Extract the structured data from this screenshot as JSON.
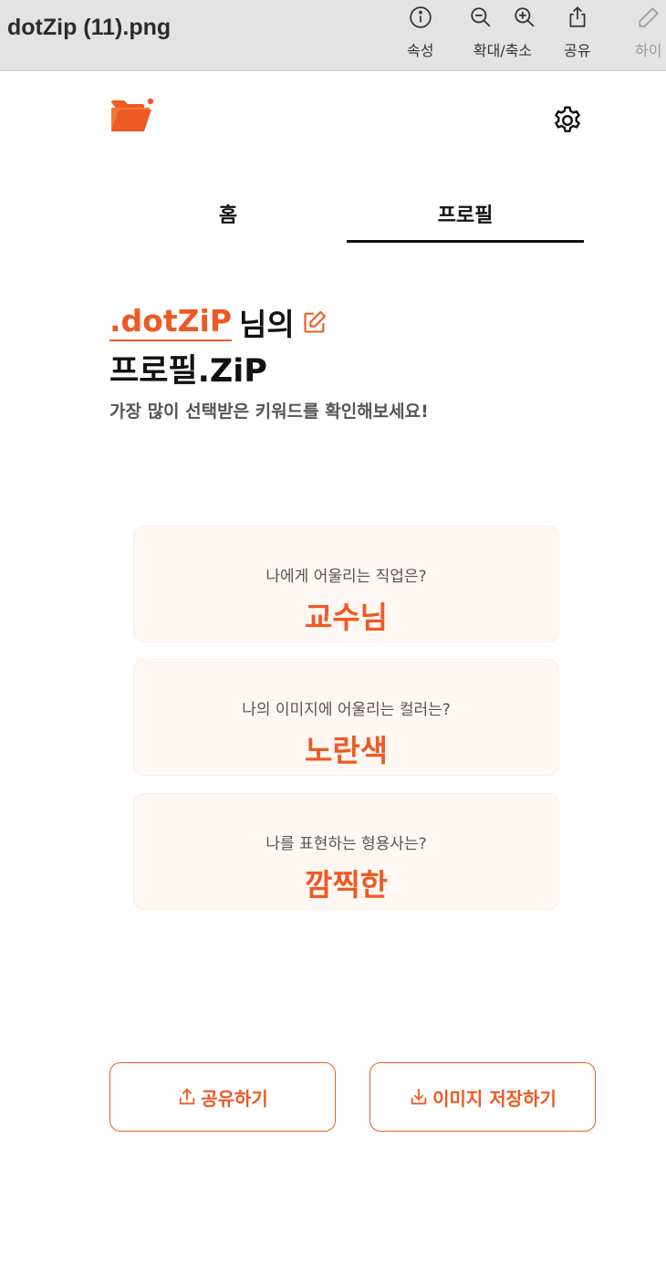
{
  "window": {
    "file_title": "dotZip (11).png",
    "tools": {
      "info_label": "속성",
      "zoom_label": "확대/축소",
      "share_label": "공유",
      "highlight_label": "하이"
    }
  },
  "app": {
    "tabs": [
      {
        "label": "홈",
        "active": false
      },
      {
        "label": "프로필",
        "active": true
      }
    ],
    "profile": {
      "name": ".dotZiP",
      "name_suffix": "님의",
      "title": "프로필.ZiP",
      "subtitle": "가장 많이 선택받은 키워드를 확인해보세요!"
    },
    "cards": [
      {
        "question": "나에게 어울리는 직업은?",
        "answer": "교수님"
      },
      {
        "question": "나의 이미지에 어울리는 컬러는?",
        "answer": "노란색"
      },
      {
        "question": "나를 표현하는 형용사는?",
        "answer": "깜찍한"
      }
    ],
    "buttons": {
      "share": "공유하기",
      "save_image": "이미지 저장하기"
    }
  },
  "colors": {
    "accent": "#ee5a24",
    "card_background": "#fff7f3",
    "toolbar_background": "#e3e3e3"
  },
  "icons": [
    "info-icon",
    "zoom-out-icon",
    "zoom-in-icon",
    "share-icon",
    "pencil-icon",
    "folder-logo-icon",
    "gear-icon",
    "edit-icon",
    "upload-icon",
    "download-icon"
  ]
}
